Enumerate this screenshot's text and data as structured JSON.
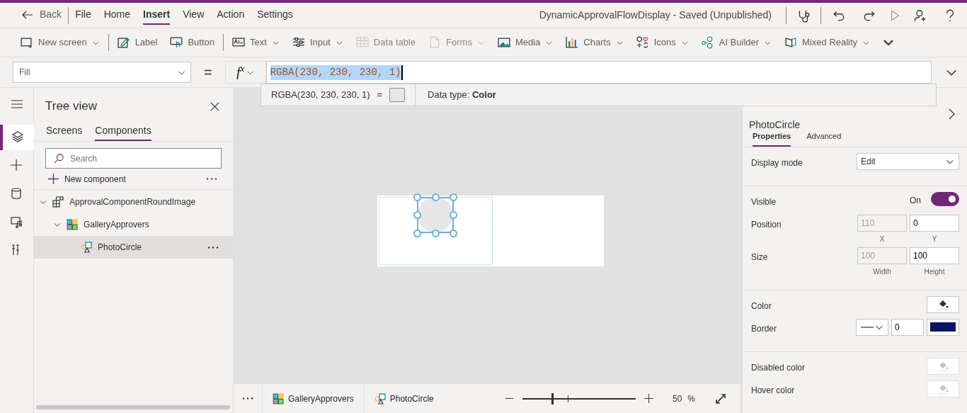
{
  "menu": {
    "back": "Back",
    "items": [
      {
        "label": "File",
        "selected": false
      },
      {
        "label": "Home",
        "selected": false
      },
      {
        "label": "Insert",
        "selected": true
      },
      {
        "label": "View",
        "selected": false
      },
      {
        "label": "Action",
        "selected": false
      },
      {
        "label": "Settings",
        "selected": false
      }
    ]
  },
  "title": "DynamicApprovalFlowDisplay - Saved (Unpublished)",
  "toolbar": [
    [
      {
        "label": "New screen",
        "kind": "screen",
        "dropdown": true,
        "disabled": false
      }
    ],
    [
      {
        "label": "Label",
        "kind": "label",
        "dropdown": false,
        "disabled": false
      },
      {
        "label": "Button",
        "kind": "button",
        "dropdown": false,
        "disabled": false
      }
    ],
    [
      {
        "label": "Text",
        "kind": "text",
        "dropdown": true,
        "disabled": false
      },
      {
        "label": "Input",
        "kind": "input",
        "dropdown": true,
        "disabled": false
      },
      {
        "label": "Data table",
        "kind": "table",
        "dropdown": false,
        "disabled": true
      },
      {
        "label": "Forms",
        "kind": "forms",
        "dropdown": true,
        "disabled": true
      },
      {
        "label": "Media",
        "kind": "media",
        "dropdown": true,
        "disabled": false
      },
      {
        "label": "Charts",
        "kind": "charts",
        "dropdown": true,
        "disabled": false
      },
      {
        "label": "Icons",
        "kind": "icons",
        "dropdown": true,
        "disabled": false
      },
      {
        "label": "AI Builder",
        "kind": "ai",
        "dropdown": true,
        "disabled": false
      },
      {
        "label": "Mixed Reality",
        "kind": "mr",
        "dropdown": true,
        "disabled": false
      }
    ]
  ],
  "formula": {
    "property": "Fill",
    "bar_equals": "=",
    "fx": "f$^{x}$",
    "expression": "RGBA(230, 230, 230, 1)",
    "result": "RGBA(230, 230, 230, 1)",
    "equals": "=",
    "data_type": "Data type: **Color**"
  },
  "rail": [
    {
      "kind": "menu",
      "selected": false
    },
    {
      "kind": "layers",
      "selected": true
    },
    {
      "kind": "plus",
      "selected": false
    },
    {
      "kind": "data",
      "selected": false
    },
    {
      "kind": "media",
      "selected": false
    },
    {
      "kind": "tools",
      "selected": false
    }
  ],
  "tree": {
    "title": "Tree view",
    "tabs": [
      {
        "label": "Screens",
        "selected": false
      },
      {
        "label": "Components",
        "selected": true
      }
    ],
    "search": {
      "placeholder": "Search"
    },
    "new_component": "New component",
    "nodes": [
      {
        "label": "ApprovalComponentRoundImage",
        "kind": "component",
        "expanded": true,
        "selected": false,
        "children": [
          {
            "label": "GalleryApprovers",
            "kind": "gallery",
            "expanded": true,
            "selected": false,
            "children": [
              {
                "label": "PhotoCircle",
                "kind": "image",
                "selected": true
              }
            ]
          }
        ]
      }
    ]
  },
  "status": {
    "breadcrumb": [
      {
        "label": "GalleryApprovers",
        "kind": "gallery"
      },
      {
        "label": "PhotoCircle",
        "kind": "image"
      }
    ],
    "zoom": {
      "level": 0.26,
      "value": "50",
      "unit": "%"
    }
  },
  "properties": {
    "name": "PhotoCircle",
    "tabs": [
      {
        "label": "Properties",
        "selected": true
      },
      {
        "label": "Advanced",
        "selected": false
      }
    ],
    "sections": [
      [
        {
          "kind": "dropdown",
          "label": "Display mode",
          "value": "Edit"
        }
      ],
      [
        {
          "kind": "toggle",
          "label": "Visible",
          "state": "On",
          "on": true
        },
        {
          "kind": "pair",
          "label": "Position",
          "first": {
            "value": "110",
            "caption": "X",
            "disabled": true
          },
          "second": {
            "value": "0",
            "caption": "Y",
            "disabled": false
          }
        },
        {
          "kind": "pair",
          "label": "Size",
          "first": {
            "value": "100",
            "caption": "Width",
            "disabled": true
          },
          "second": {
            "value": "100",
            "caption": "Height",
            "disabled": false
          }
        }
      ],
      [
        {
          "kind": "color",
          "label": "Color",
          "disabled": false
        },
        {
          "kind": "border",
          "label": "Border",
          "value": "0",
          "color": "#0a1464"
        }
      ],
      [
        {
          "kind": "color",
          "label": "Disabled color",
          "disabled": true
        },
        {
          "kind": "color",
          "label": "Hover color",
          "disabled": true
        }
      ]
    ]
  }
}
